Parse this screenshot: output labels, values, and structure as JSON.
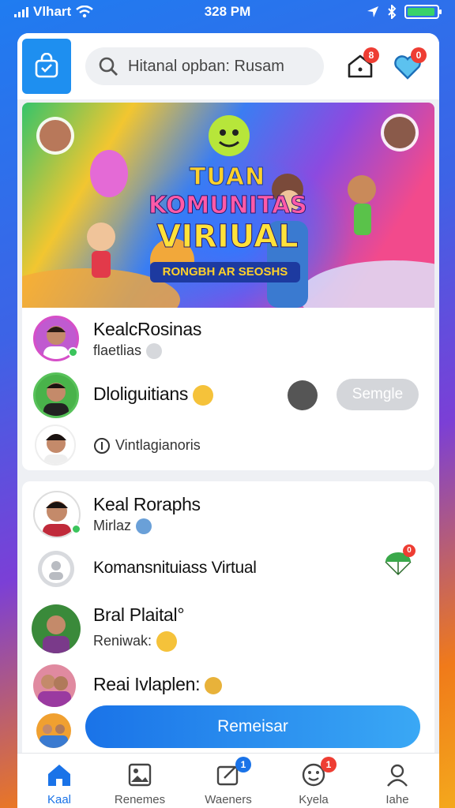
{
  "status_bar": {
    "carrier": "Vlhart",
    "time": "328 PM",
    "battery_level": 0.95
  },
  "header": {
    "search_placeholder": "Hitanal opban: Rusam",
    "notifications_count": "8",
    "favorites_count": "0"
  },
  "banner": {
    "title_line1": "TUAN",
    "title_line2": "KOMUNITAS",
    "title_line3": "VIRIUAL",
    "subtitle": "RONGBH AR SEOSHS"
  },
  "group1": {
    "row1": {
      "name": "KealcRosinas",
      "sub": "flaetlias"
    },
    "row2": {
      "name": "Dloliguitians",
      "action_label": "Semgle"
    },
    "row3": {
      "sub": "Vintlagianoris"
    }
  },
  "group2": {
    "row1": {
      "name": "Keal Roraphs",
      "sub": "Mirlaz"
    },
    "row2": {
      "name": "Komansnituiass Virtual",
      "badge": "0"
    },
    "row3": {
      "name": "Bral Plaital°",
      "sub": "Reniwak:"
    },
    "row4": {
      "name": "Reai Ivlaplen:"
    },
    "primary_button": "Remeisar"
  },
  "bottom_nav": {
    "items": [
      {
        "label": "Kaal",
        "icon": "home-icon",
        "active": true
      },
      {
        "label": "Renemes",
        "icon": "gallery-icon"
      },
      {
        "label": "Waeners",
        "icon": "compose-icon",
        "badge": "1"
      },
      {
        "label": "Kyela",
        "icon": "smile-icon",
        "badge": "1"
      },
      {
        "label": "Iahe",
        "icon": "profile-icon"
      }
    ]
  },
  "colors": {
    "accent": "#1a73e8",
    "badge": "#ee3d33",
    "online": "#3bc45c"
  }
}
